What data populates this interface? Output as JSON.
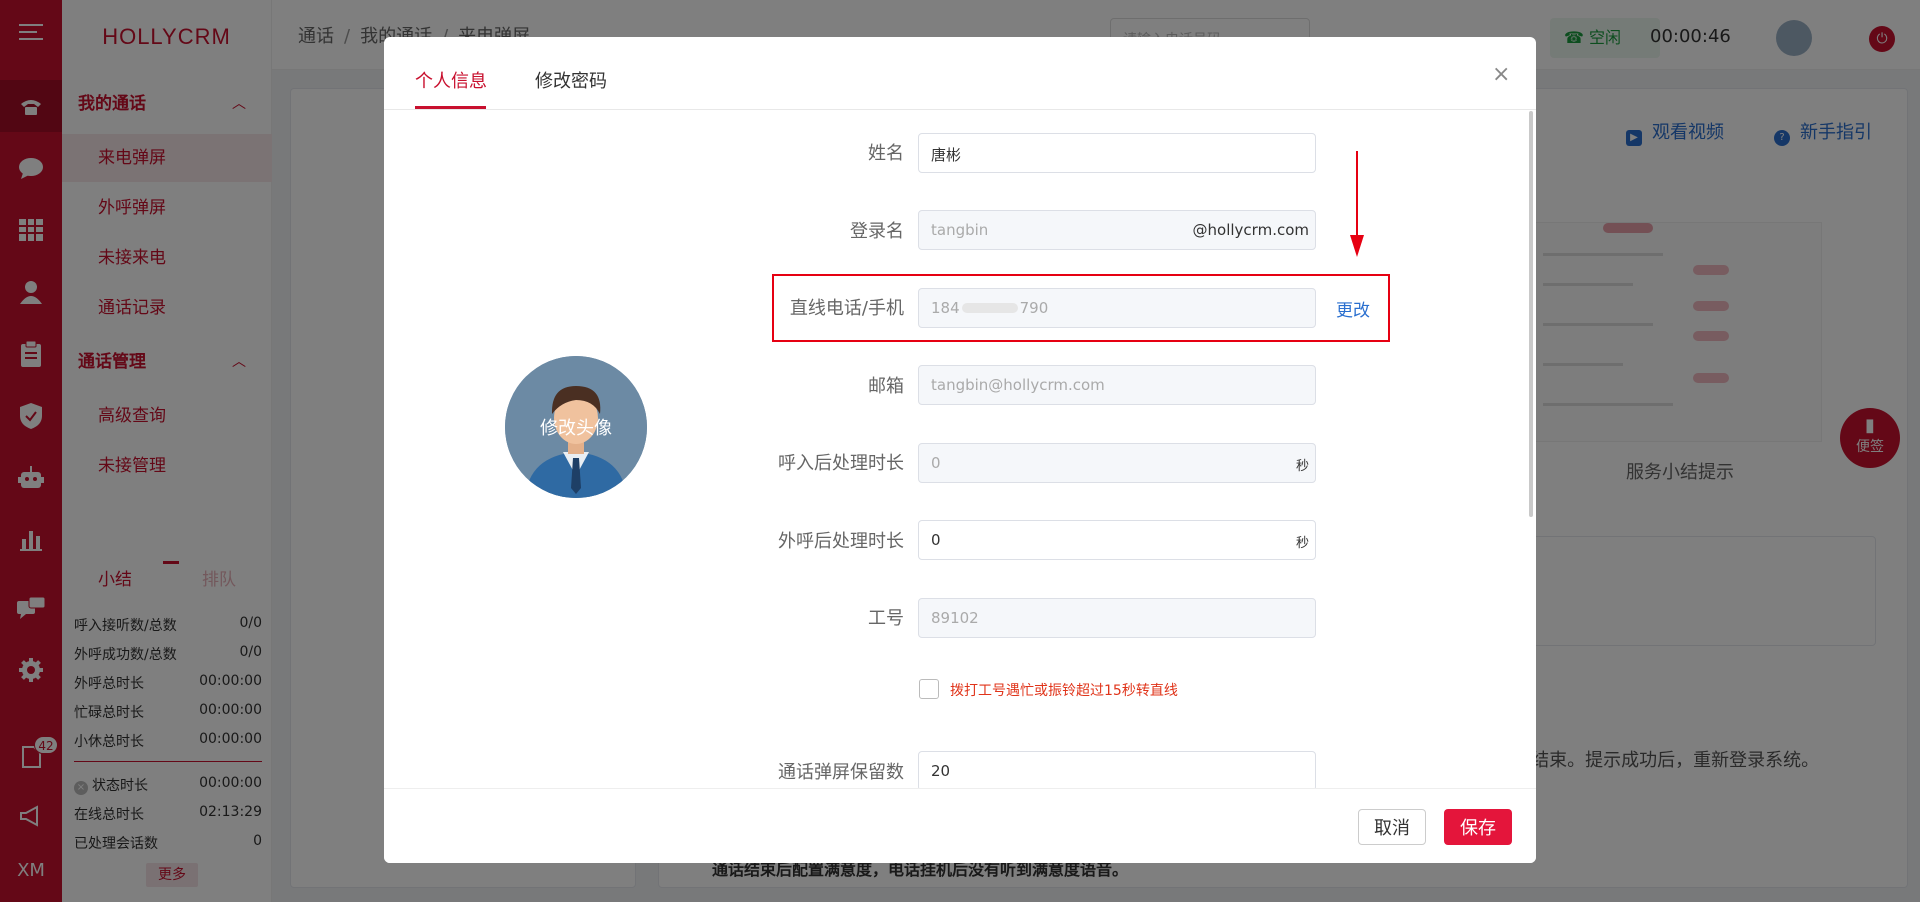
{
  "app": {
    "brand": "HOLLYCRM",
    "badge_count": "42",
    "footer_initials": "XM"
  },
  "sidebar": {
    "group1": {
      "label": "我的通话",
      "chevron": "^"
    },
    "group1_items": [
      "来电弹屏",
      "外呼弹屏",
      "未接来电",
      "通话记录"
    ],
    "group2": {
      "label": "通话管理",
      "chevron": "^"
    },
    "group2_items": [
      "高级查询",
      "未接管理"
    ],
    "stats": {
      "tab_summary": "小结",
      "tab_queue": "排队",
      "rows_top": [
        {
          "label": "呼入接听数/总数",
          "value": "0/0"
        },
        {
          "label": "外呼成功数/总数",
          "value": "0/0"
        },
        {
          "label": "外呼总时长",
          "value": "00:00:00"
        },
        {
          "label": "忙碌总时长",
          "value": "00:00:00"
        },
        {
          "label": "小休总时长",
          "value": "00:00:00"
        }
      ],
      "rows_bottom": [
        {
          "label": "状态时长",
          "value": "00:00:00"
        },
        {
          "label": "在线总时长",
          "value": "02:13:29"
        },
        {
          "label": "已处理会话数",
          "value": "0"
        }
      ],
      "more": "更多"
    }
  },
  "topbar": {
    "breadcrumb": [
      "通话",
      "我的通话",
      "来电弹屏"
    ],
    "search_placeholder": "请输入电话号码",
    "status": "空闲",
    "timer": "00:00:46"
  },
  "background": {
    "watch_video": "观看视频",
    "beginner_guide": "新手指引",
    "summary_tip": "服务小结提示",
    "note_button": "便签",
    "tip_line1": "#结束。提示成功后，重新登录系统。",
    "tip_line2": "通话结束后配置满意度，电话挂机后没有听到满意度语音。"
  },
  "modal": {
    "tab_profile": "个人信息",
    "tab_password": "修改密码",
    "close_glyph": "×",
    "avatar_label": "修改头像",
    "fields": {
      "name": {
        "label": "姓名",
        "value": "唐彬"
      },
      "login": {
        "label": "登录名",
        "value": "tangbin",
        "suffix": "@hollycrm.com"
      },
      "phone": {
        "label": "直线电话/手机",
        "prefix": "184",
        "suffix_digits": "790",
        "action": "更改"
      },
      "email": {
        "label": "邮箱",
        "value": "tangbin@hollycrm.com"
      },
      "inbound_wrap": {
        "label": "呼入后处理时长",
        "value": "0",
        "unit": "秒"
      },
      "outbound_wrap": {
        "label": "外呼后处理时长",
        "value": "0",
        "unit": "秒"
      },
      "employee_no": {
        "label": "工号",
        "value": "89102"
      },
      "transfer_checkbox": {
        "label": "拨打工号遇忙或振铃超过15秒转直线",
        "checked": false
      },
      "screen_keep": {
        "label": "通话弹屏保留数",
        "value": "20"
      }
    },
    "buttons": {
      "cancel": "取消",
      "save": "保存"
    }
  },
  "colors": {
    "brand_red": "#c8102e",
    "highlight_red": "#e60012",
    "link_blue": "#2a6fcf",
    "status_green": "#1a9c3e"
  }
}
